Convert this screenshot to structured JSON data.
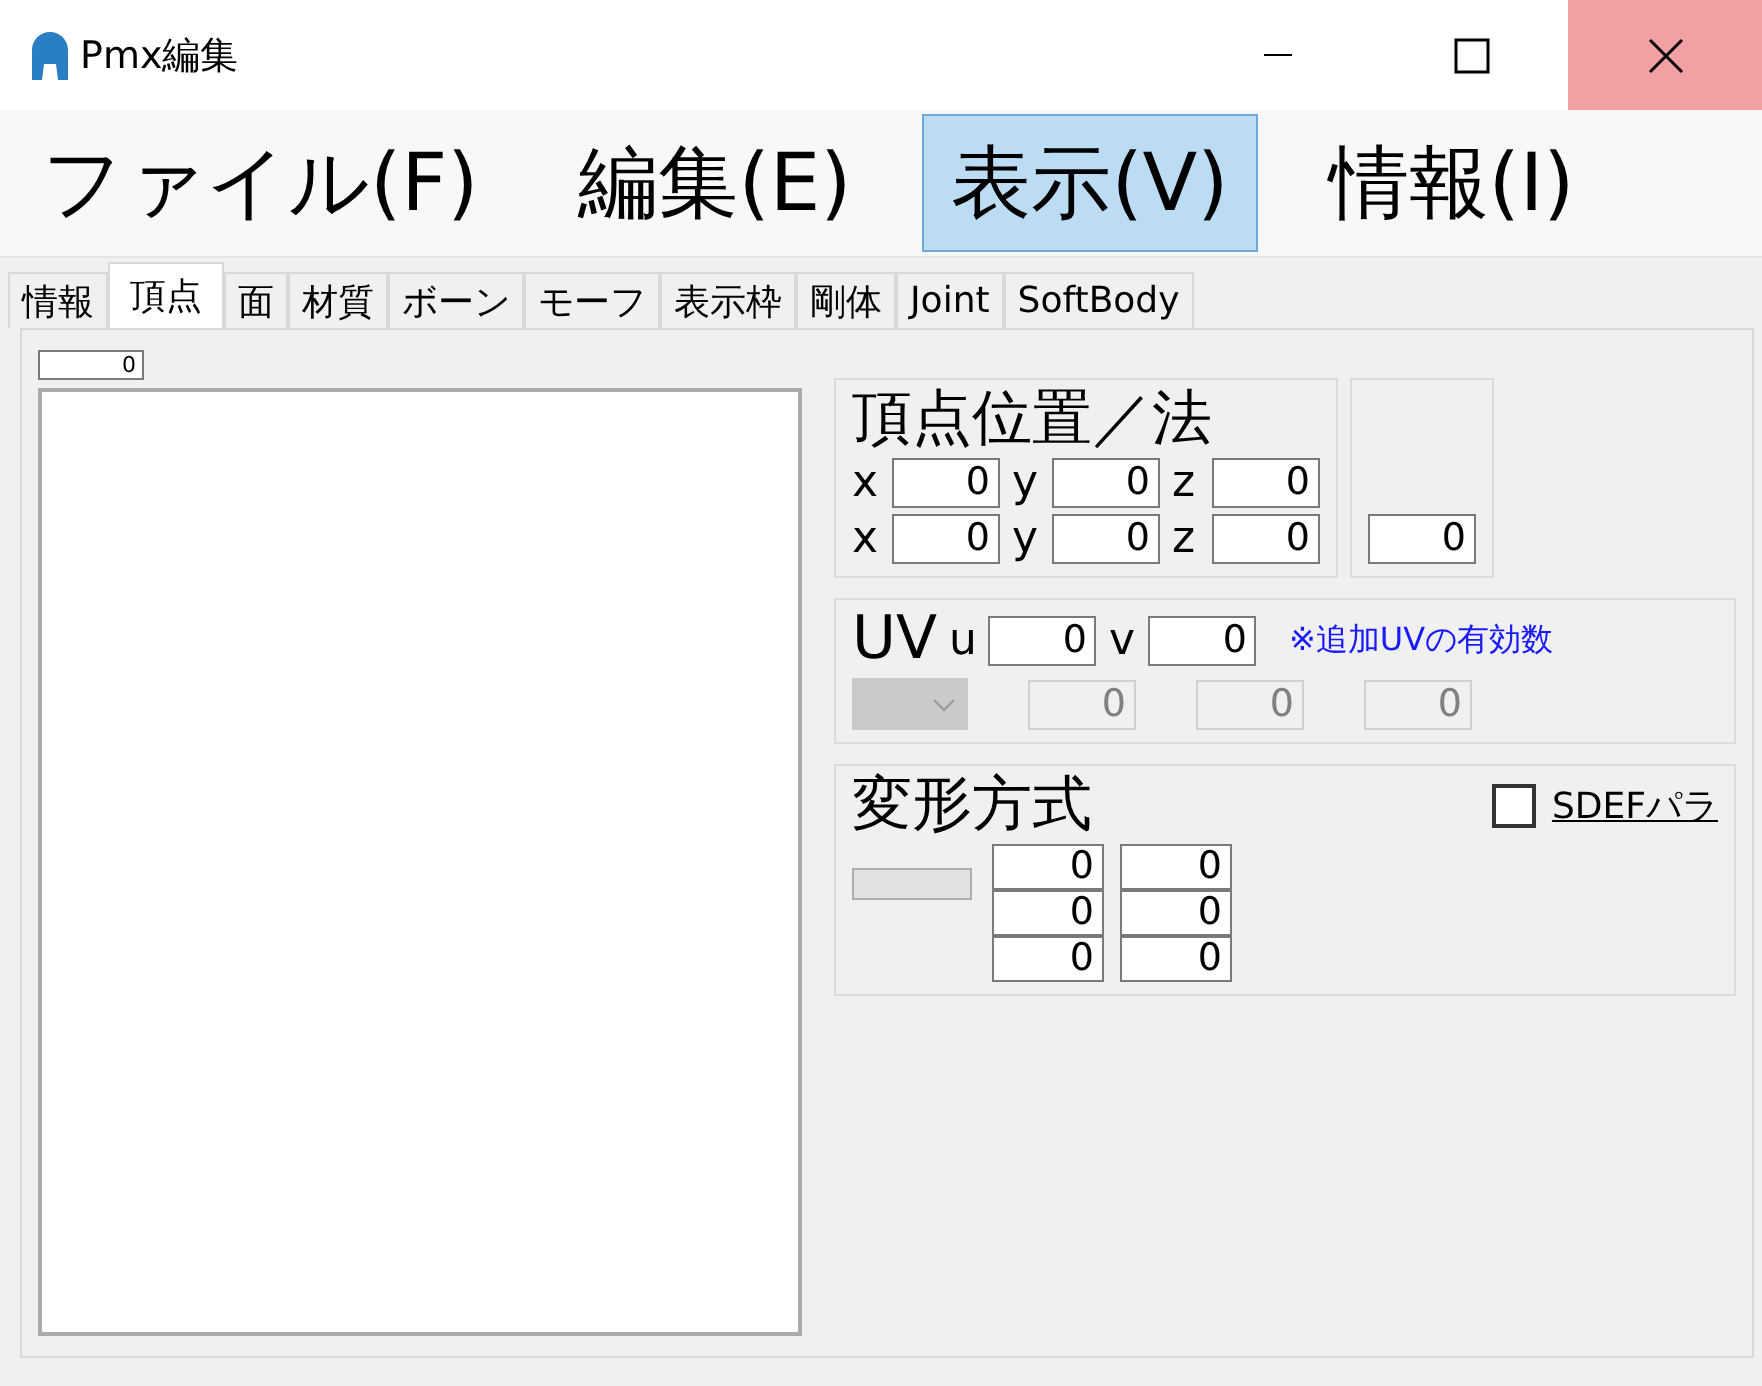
{
  "window": {
    "title": "Pmx編集"
  },
  "menu": [
    {
      "label": "ファイル(F)",
      "selected": false
    },
    {
      "label": "編集(E)",
      "selected": false
    },
    {
      "label": "表示(V)",
      "selected": true
    },
    {
      "label": "情報(I)",
      "selected": false
    }
  ],
  "tabs": [
    {
      "label": "情報",
      "selected": false
    },
    {
      "label": "頂点",
      "selected": true
    },
    {
      "label": "面",
      "selected": false
    },
    {
      "label": "材質",
      "selected": false
    },
    {
      "label": "ボーン",
      "selected": false
    },
    {
      "label": "モーフ",
      "selected": false
    },
    {
      "label": "表示枠",
      "selected": false
    },
    {
      "label": "剛体",
      "selected": false
    },
    {
      "label": "Joint",
      "selected": false
    },
    {
      "label": "SoftBody",
      "selected": false
    }
  ],
  "vertex_list": {
    "index": "0"
  },
  "position_group": {
    "title": "頂点位置／法",
    "rows": [
      {
        "fields": [
          {
            "label": "x",
            "value": "0"
          },
          {
            "label": "y",
            "value": "0"
          },
          {
            "label": "z",
            "value": "0"
          }
        ]
      },
      {
        "fields": [
          {
            "label": "x",
            "value": "0"
          },
          {
            "label": "y",
            "value": "0"
          },
          {
            "label": "z",
            "value": "0"
          }
        ]
      }
    ]
  },
  "edge_group": {
    "value": "0"
  },
  "uv_group": {
    "title": "UV",
    "fields": [
      {
        "label": "u",
        "value": "0"
      },
      {
        "label": "v",
        "value": "0"
      }
    ],
    "note": "※追加UVの有効数",
    "extra_values": [
      {
        "value": "0",
        "disabled": true
      },
      {
        "value": "0",
        "disabled": true
      },
      {
        "value": "0",
        "disabled": true
      }
    ]
  },
  "deform_group": {
    "title": "変形方式",
    "sdef": {
      "label": "SDEFパラ",
      "checked": false
    },
    "weights": [
      [
        "0",
        "0"
      ],
      [
        "0",
        "0"
      ],
      [
        "0",
        "0"
      ]
    ]
  }
}
